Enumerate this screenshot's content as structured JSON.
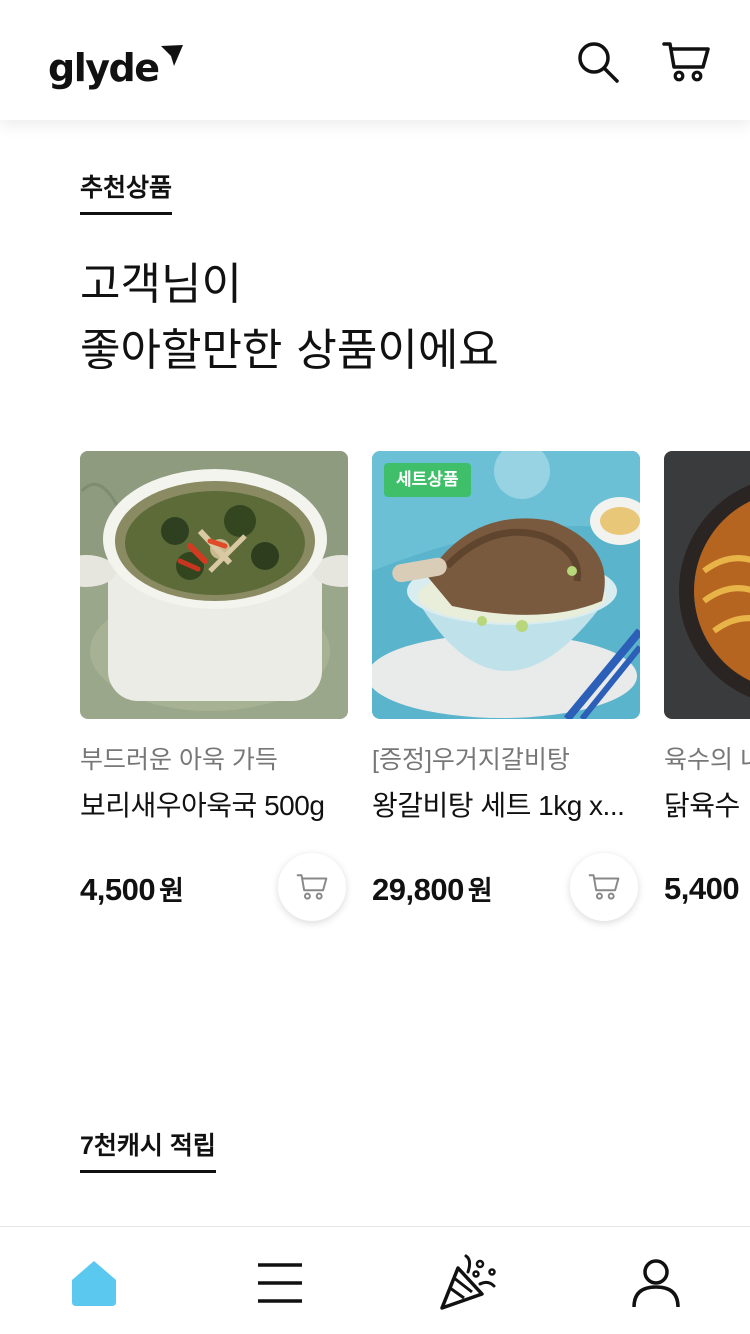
{
  "header": {
    "logo": "glyde",
    "search_icon": "search-icon",
    "cart_icon": "cart-icon"
  },
  "recommend": {
    "label": "추천상품",
    "headline_line1": "고객님이",
    "headline_line2": "좋아할만한 상품이에요",
    "products": [
      {
        "subtitle": "부드러운 아욱 가득",
        "name": "보리새우아욱국 500g",
        "price": "4,500",
        "currency": "원",
        "badge": "",
        "image": "soup-pot-image"
      },
      {
        "subtitle": "[증정]우거지갈비탕",
        "name": "왕갈비탕 세트 1kg x...",
        "price": "29,800",
        "currency": "원",
        "badge": "세트상품",
        "image": "galbitang-image"
      },
      {
        "subtitle": "육수의 내",
        "name": "닭육수",
        "price": "5,400",
        "currency": "",
        "badge": "",
        "image": "noodle-image"
      }
    ]
  },
  "cash": {
    "label": "7천캐시 적립"
  },
  "tabbar": {
    "tabs": [
      "home-icon",
      "menu-icon",
      "party-popper-icon",
      "profile-icon"
    ],
    "active_color": "#5bc8f0"
  }
}
